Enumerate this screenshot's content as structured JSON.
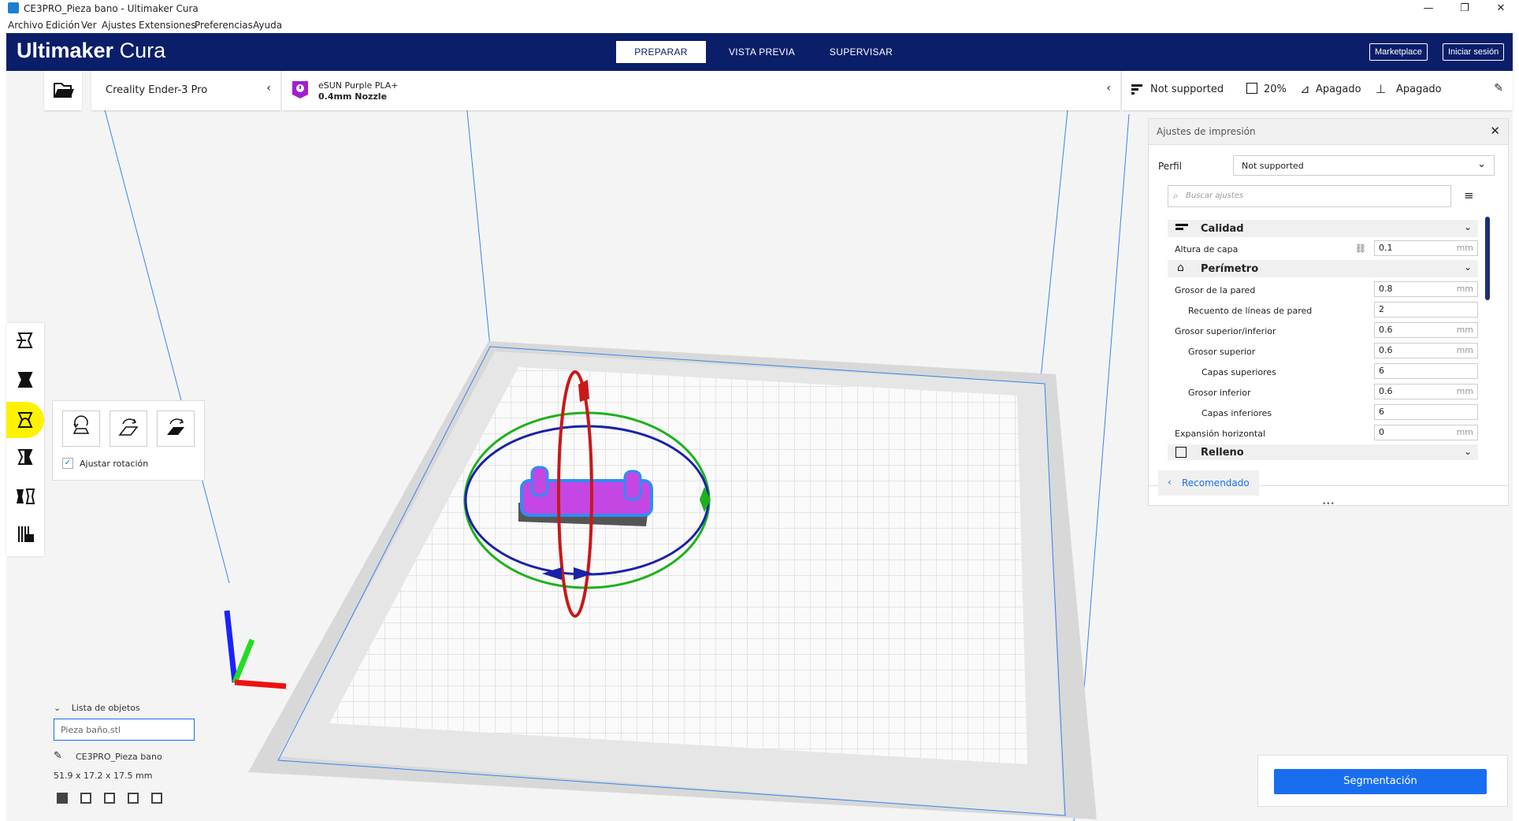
{
  "window": {
    "title": "CE3PRO_Pieza bano - Ultimaker Cura",
    "controls": {
      "minimize": "—",
      "maximize": "❐",
      "close": "✕"
    }
  },
  "menu": [
    "Archivo",
    "Edición",
    "Ver",
    "Ajustes",
    "Extensiones",
    "Preferencias",
    "Ayuda"
  ],
  "header": {
    "logo_bold": "Ultimaker",
    "logo_light": "Cura",
    "tabs": [
      {
        "label": "PREPARAR",
        "active": true
      },
      {
        "label": "VISTA PREVIA",
        "active": false
      },
      {
        "label": "SUPERVISAR",
        "active": false
      }
    ],
    "marketplace": "Marketplace",
    "login": "Iniciar sesión"
  },
  "printer": {
    "name": "Creality Ender-3 Pro"
  },
  "material": {
    "name": "eSUN Purple PLA+",
    "nozzle": "0.4mm Nozzle"
  },
  "print_setup": {
    "profile": "Not supported",
    "infill": "20%",
    "support": "Apagado",
    "adhesion": "Apagado"
  },
  "rotate_panel": {
    "checkbox_label": "Ajustar rotación",
    "checked": true
  },
  "settings_panel": {
    "title": "Ajustes de impresión",
    "profile_label": "Perfil",
    "profile_value": "Not supported",
    "search_placeholder": "Buscar ajustes",
    "categories": {
      "calidad": "Calidad",
      "perimetro": "Perímetro",
      "relleno": "Relleno"
    },
    "settings": [
      {
        "label": "Altura de capa",
        "value": "0.1",
        "unit": "mm"
      },
      {
        "label": "Grosor de la pared",
        "value": "0.8",
        "unit": "mm"
      },
      {
        "label": "Recuento de líneas de pared",
        "value": "2",
        "unit": ""
      },
      {
        "label": "Grosor superior/inferior",
        "value": "0.6",
        "unit": "mm"
      },
      {
        "label": "Grosor superior",
        "value": "0.6",
        "unit": "mm"
      },
      {
        "label": "Capas superiores",
        "value": "6",
        "unit": ""
      },
      {
        "label": "Grosor inferior",
        "value": "0.6",
        "unit": "mm"
      },
      {
        "label": "Capas inferiores",
        "value": "6",
        "unit": ""
      },
      {
        "label": "Expansión horizontal",
        "value": "0",
        "unit": "mm"
      }
    ],
    "recommended_button": "Recomendado",
    "more": "•••"
  },
  "object_list": {
    "header": "Lista de objetos",
    "item": "Pieza baño.stl",
    "project": "CE3PRO_Pieza bano",
    "dimensions": "51.9 x 17.2 x 17.5 mm"
  },
  "slice_button": "Segmentación",
  "colors": {
    "header_bg": "#0a1e6a",
    "accent": "#196ef0",
    "model": "#c447e3",
    "model_outline": "#2f8cf5",
    "highlight": "#fff200",
    "rot_red": "#c81818",
    "rot_green": "#1db11d",
    "rot_blue": "#1a22a6"
  }
}
